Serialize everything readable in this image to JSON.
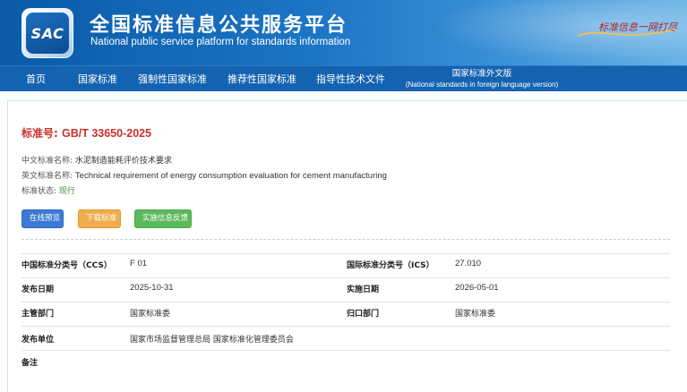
{
  "header": {
    "logo_text": "SAC",
    "title": "全国标准信息公共服务平台",
    "subtitle": "National public service platform  for standards information",
    "slogan": "标准信息一网打尽"
  },
  "nav": {
    "items": [
      "首页",
      "国家标准",
      "强制性国家标准",
      "推荐性国家标准",
      "指导性技术文件"
    ],
    "foreign": {
      "label": "国家标准外文版",
      "sublabel": "(National standards in foreign language version)"
    }
  },
  "standard": {
    "number_label": "标准号:",
    "number": "GB/T 33650-2025",
    "cn_name_label": "中文标准名称:",
    "cn_name": "水泥制造能耗评价技术要求",
    "en_name_label": "英文标准名称:",
    "en_name": "Technical requirement of energy consumption evaluation for cement manufacturing",
    "status_label": "标准状态:",
    "status": "现行"
  },
  "buttons": {
    "preview": "在线预览",
    "download": "下载标准",
    "feedback": "实施信息反馈"
  },
  "details": {
    "ccs_label": "中国标准分类号（CCS）",
    "ccs": "F 01",
    "ics_label": "国际标准分类号（ICS）",
    "ics": "27.010",
    "publish_label": "发布日期",
    "publish": "2025-10-31",
    "implement_label": "实施日期",
    "implement": "2026-05-01",
    "competent_label": "主管部门",
    "competent": "国家标准委",
    "centralized_label": "归口部门",
    "centralized": "国家标准委",
    "issuer_label": "发布单位",
    "issuer": "国家市场监督管理总局 国家标准化管理委员会",
    "remark_label": "备注",
    "remark": ""
  },
  "colors": {
    "banner": "#1463b1",
    "number_red": "#c9302c",
    "btn_blue": "#3a7bd5",
    "btn_orange": "#f0ad4e",
    "btn_green": "#5cb85c"
  }
}
